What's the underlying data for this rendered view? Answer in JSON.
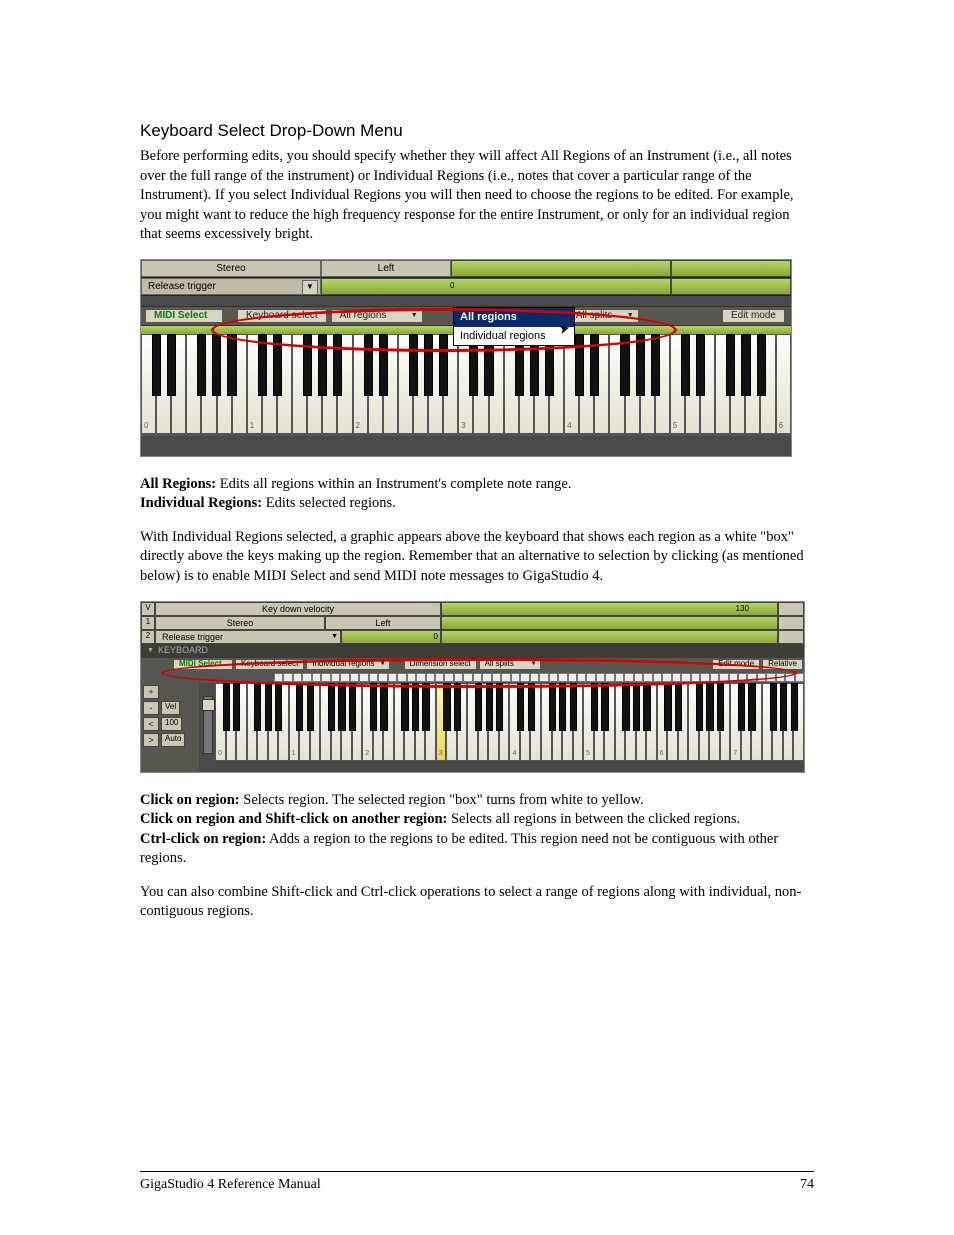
{
  "section_title": "Keyboard Select Drop-Down Menu",
  "intro_paragraph": "Before performing edits, you should specify whether they will affect All Regions of an Instrument (i.e., all notes over the full range of the instrument) or Individual Regions (i.e., notes that cover a particular range of the Instrument). If you select Individual Regions you will then need to choose the regions to be edited. For example, you might want to reduce the high frequency response for the entire Instrument, or only for an individual region that seems excessively bright.",
  "screenshot1": {
    "stereo_label": "Stereo",
    "left_label": "Left",
    "release_trigger_label": "Release trigger",
    "zero_marker": "0",
    "toolbar": {
      "midi_select": "MIDI Select",
      "keyboard_select": "Keyboard select",
      "all_regions_dd": "All regions",
      "all_splits_dd": "All splits",
      "edit_mode": "Edit mode"
    },
    "popup": {
      "opt1": "All regions",
      "opt2": "Individual regions"
    },
    "octaves": [
      "0",
      "1",
      "2",
      "3",
      "4",
      "5",
      "6"
    ]
  },
  "definitions1": {
    "all_regions_label": "All Regions:",
    "all_regions_text": " Edits all regions within an Instrument's complete note range.",
    "individual_regions_label": "Individual Regions:",
    "individual_regions_text": " Edits selected regions."
  },
  "middle_paragraph": "With Individual Regions selected, a graphic appears above the keyboard that shows each region as a white \"box\" directly above the keys making up the region. Remember that an alternative to selection by clicking (as mentioned below) is to enable MIDI Select and send MIDI note messages to GigaStudio 4.",
  "screenshot2": {
    "row_v": "V",
    "row_v_label": "Key down velocity",
    "row_v_value": "130",
    "row_1": "1",
    "row1_stereo": "Stereo",
    "row1_left": "Left",
    "row_2": "2",
    "row2_release": "Release trigger",
    "row2_zero": "0",
    "keyboard_header": "KEYBOARD",
    "toolbar": {
      "midi_select": "MIDI Select",
      "keyboard_select": "Keyboard select",
      "individual_regions": "Individual regions",
      "dimension_select": "Dimension select",
      "all_splits": "All splits",
      "edit_mode": "Edit mode",
      "relative": "Relative"
    },
    "left_panel": {
      "plus": "+",
      "minus": "-",
      "vel_label": "Vel",
      "lt": "<",
      "hundred": "100",
      "gt": ">",
      "auto": "Auto"
    },
    "octaves": [
      "0",
      "1",
      "2",
      "3",
      "4",
      "5",
      "6",
      "7"
    ]
  },
  "definitions2": {
    "click_label": "Click on region:",
    "click_text": " Selects region. The selected region \"box\" turns from white to yellow.",
    "shift_label": "Click on region and Shift-click on another region:",
    "shift_text": " Selects all regions in between the clicked regions.",
    "ctrl_label": "Ctrl-click on region:",
    "ctrl_text": " Adds a region to the regions to be edited. This region need not be contiguous with other regions."
  },
  "closing_paragraph": "You can also combine Shift-click and Ctrl-click operations to select a range of regions along with individual, non-contiguous regions.",
  "footer": {
    "title": "GigaStudio 4 Reference Manual",
    "page": "74"
  }
}
